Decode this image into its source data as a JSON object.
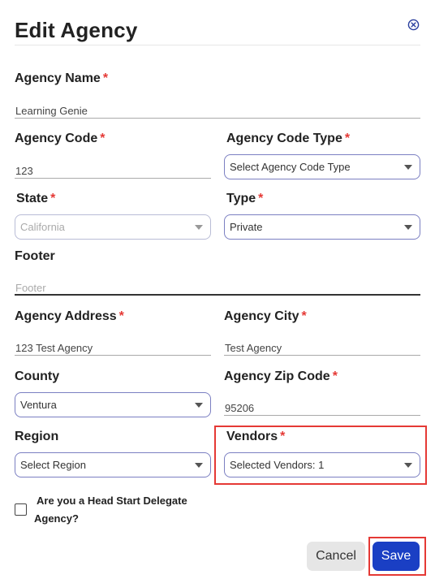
{
  "dialog": {
    "title": "Edit Agency",
    "close_icon": "close-circle-icon"
  },
  "form": {
    "agency_name": {
      "label": "Agency Name",
      "required": "*",
      "value": "Learning Genie"
    },
    "agency_code": {
      "label": "Agency Code",
      "required": "*",
      "value": "123"
    },
    "agency_code_type": {
      "label": "Agency Code Type",
      "required": "*",
      "value": "Select Agency Code Type"
    },
    "state": {
      "label": "State",
      "required": "*",
      "value": "California"
    },
    "type": {
      "label": "Type",
      "required": "*",
      "value": "Private"
    },
    "footer": {
      "label": "Footer",
      "placeholder": "Footer"
    },
    "agency_address": {
      "label": "Agency Address",
      "required": "*",
      "value": "123 Test Agency"
    },
    "agency_city": {
      "label": "Agency City",
      "required": "*",
      "value": "Test Agency"
    },
    "county": {
      "label": "County",
      "value": "Ventura"
    },
    "agency_zip": {
      "label": "Agency Zip Code",
      "required": "*",
      "value": "95206"
    },
    "region": {
      "label": "Region",
      "value": "Select Region"
    },
    "vendors": {
      "label": "Vendors",
      "required": "*",
      "value": "Selected Vendors: 1"
    },
    "head_start": {
      "label": "Are you a Head Start Delegate Agency?",
      "checked": false
    }
  },
  "actions": {
    "cancel_label": "Cancel",
    "save_label": "Save"
  },
  "colors": {
    "primary": "#1a3fc4",
    "required": "#e53935",
    "select_border": "#7b7fc2",
    "highlight": "#e53935"
  }
}
